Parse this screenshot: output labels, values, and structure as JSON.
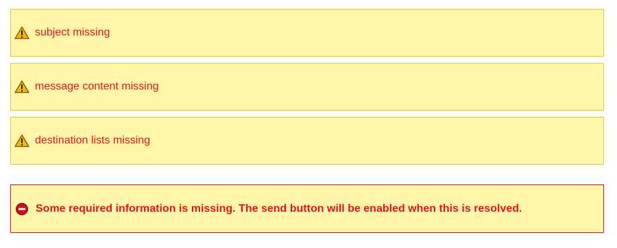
{
  "warnings": [
    {
      "icon": "warning-icon",
      "text": "subject missing"
    },
    {
      "icon": "warning-icon",
      "text": "message content missing"
    },
    {
      "icon": "warning-icon",
      "text": "destination lists missing"
    }
  ],
  "error": {
    "icon": "stop-icon",
    "text": "Some required information is missing. The send button will be enabled when this is resolved."
  },
  "colors": {
    "panel_background": "#fff5a8",
    "warning_border": "#e9c920",
    "error_border": "#d4141a",
    "message_text": "#e0161b"
  }
}
